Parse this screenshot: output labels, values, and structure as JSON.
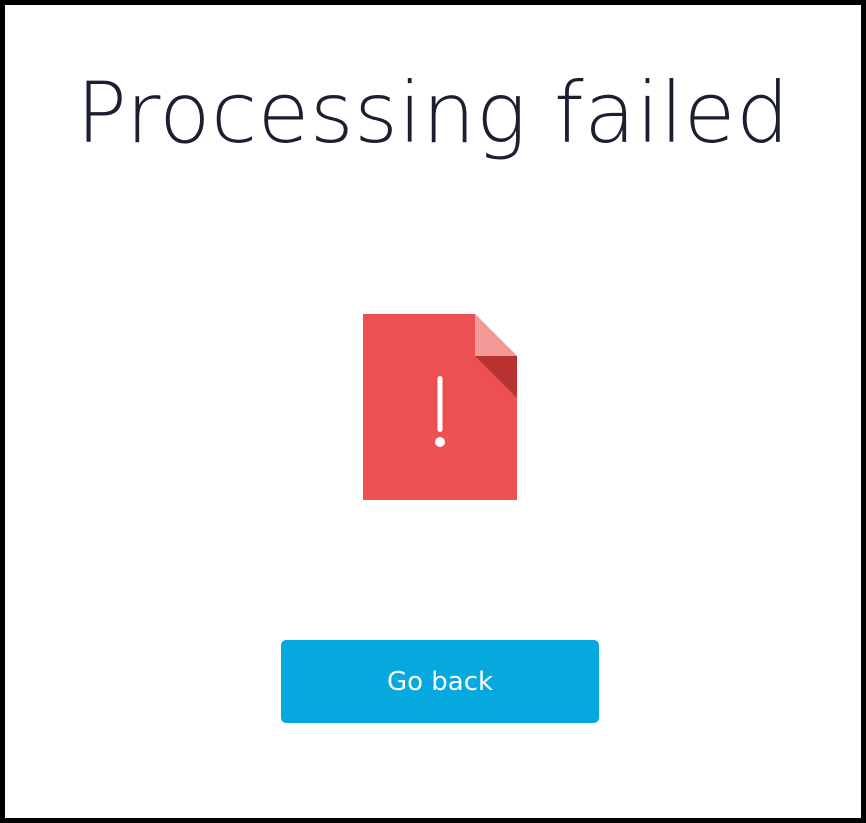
{
  "title": "Processing failed",
  "icon": {
    "name": "file-error-icon",
    "color": "#ed5051",
    "fold_light": "#f39a99",
    "fold_dark": "#b83232",
    "mark": "!"
  },
  "actions": {
    "go_back_label": "Go back"
  },
  "colors": {
    "button_bg": "#06a9de",
    "button_text": "#ffffff",
    "title_text": "#1b2030"
  }
}
